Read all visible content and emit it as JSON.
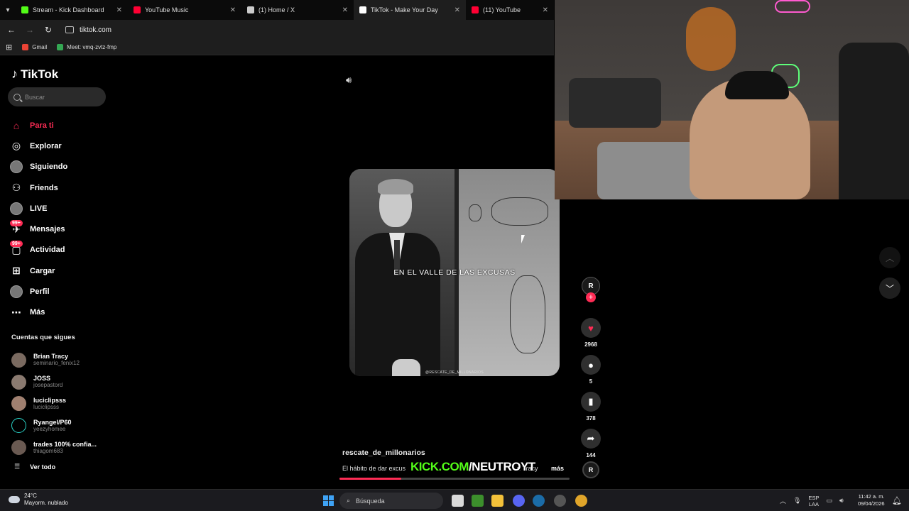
{
  "browser": {
    "tabs": [
      {
        "title": "Stream - Kick Dashboard",
        "color": "#53fc18",
        "active": false
      },
      {
        "title": "YouTube Music",
        "color": "#ff0033",
        "active": false
      },
      {
        "title": "(1) Home / X",
        "color": "#cccccc",
        "active": false
      },
      {
        "title": "TikTok - Make Your Day",
        "color": "#ffffff",
        "active": true
      },
      {
        "title": "(11) YouTube",
        "color": "#ff0033",
        "active": false
      }
    ],
    "url": "tiktok.com",
    "bookmarks": [
      {
        "label": "Gmail",
        "color": "#ea4335"
      },
      {
        "label": "Meet: vmq-zvtz-fmp",
        "color": "#34a853"
      }
    ]
  },
  "tiktok": {
    "brand": "TikTok",
    "search_placeholder": "Buscar",
    "accent_color": "#fe2c55",
    "nav": [
      {
        "label": "Para ti",
        "icon": "home-icon",
        "glyph": "⌂",
        "active": true
      },
      {
        "label": "Explorar",
        "icon": "compass-icon",
        "glyph": "◎"
      },
      {
        "label": "Siguiendo",
        "icon": "following-avatar-icon",
        "glyph": ""
      },
      {
        "label": "Friends",
        "icon": "friends-icon",
        "glyph": "⚇"
      },
      {
        "label": "LIVE",
        "icon": "live-avatar-icon",
        "glyph": ""
      },
      {
        "label": "Mensajes",
        "icon": "messages-icon",
        "glyph": "✈",
        "badge": "99+"
      },
      {
        "label": "Actividad",
        "icon": "activity-icon",
        "glyph": "▢",
        "badge": "99+"
      },
      {
        "label": "Cargar",
        "icon": "upload-icon",
        "glyph": "⊞"
      },
      {
        "label": "Perfil",
        "icon": "profile-avatar-icon",
        "glyph": ""
      },
      {
        "label": "Más",
        "icon": "more-icon",
        "glyph": "⋯"
      }
    ],
    "following_title": "Cuentas que sigues",
    "following": [
      {
        "name": "Brian Tracy",
        "user": "seminario_fenix12"
      },
      {
        "name": "JOSS",
        "user": "josepastord"
      },
      {
        "name": "luciclipsss",
        "user": "luciclipsss"
      },
      {
        "name": "Ryangel/P60",
        "user": "yeezyhomee"
      },
      {
        "name": "trades 100% confia...",
        "user": "thiagom683"
      }
    ],
    "see_all": "Ver todo",
    "video": {
      "caption_overlay": "EN EL VALLE DE LAS EXCUSAS",
      "watermark": "@RESCATE_DE_MILLONARIOS",
      "author": "rescate_de_millonarios",
      "description": "El hábito de dar excus",
      "description_tail": "n Tracy",
      "more": "más",
      "progress": 0.27,
      "likes": "2968",
      "comments": "5",
      "saves": "378",
      "shares": "144"
    }
  },
  "overlay": {
    "kick_part": "KICK.COM",
    "rest_part": "/NEUTROYT"
  },
  "taskbar": {
    "temperature": "24°C",
    "weather": "Mayorm. nublado",
    "search": "Búsqueda",
    "lang_top": "ESP",
    "lang_bottom": "LAA",
    "time": "11:42 a. m.",
    "date": "09/04/2026"
  }
}
